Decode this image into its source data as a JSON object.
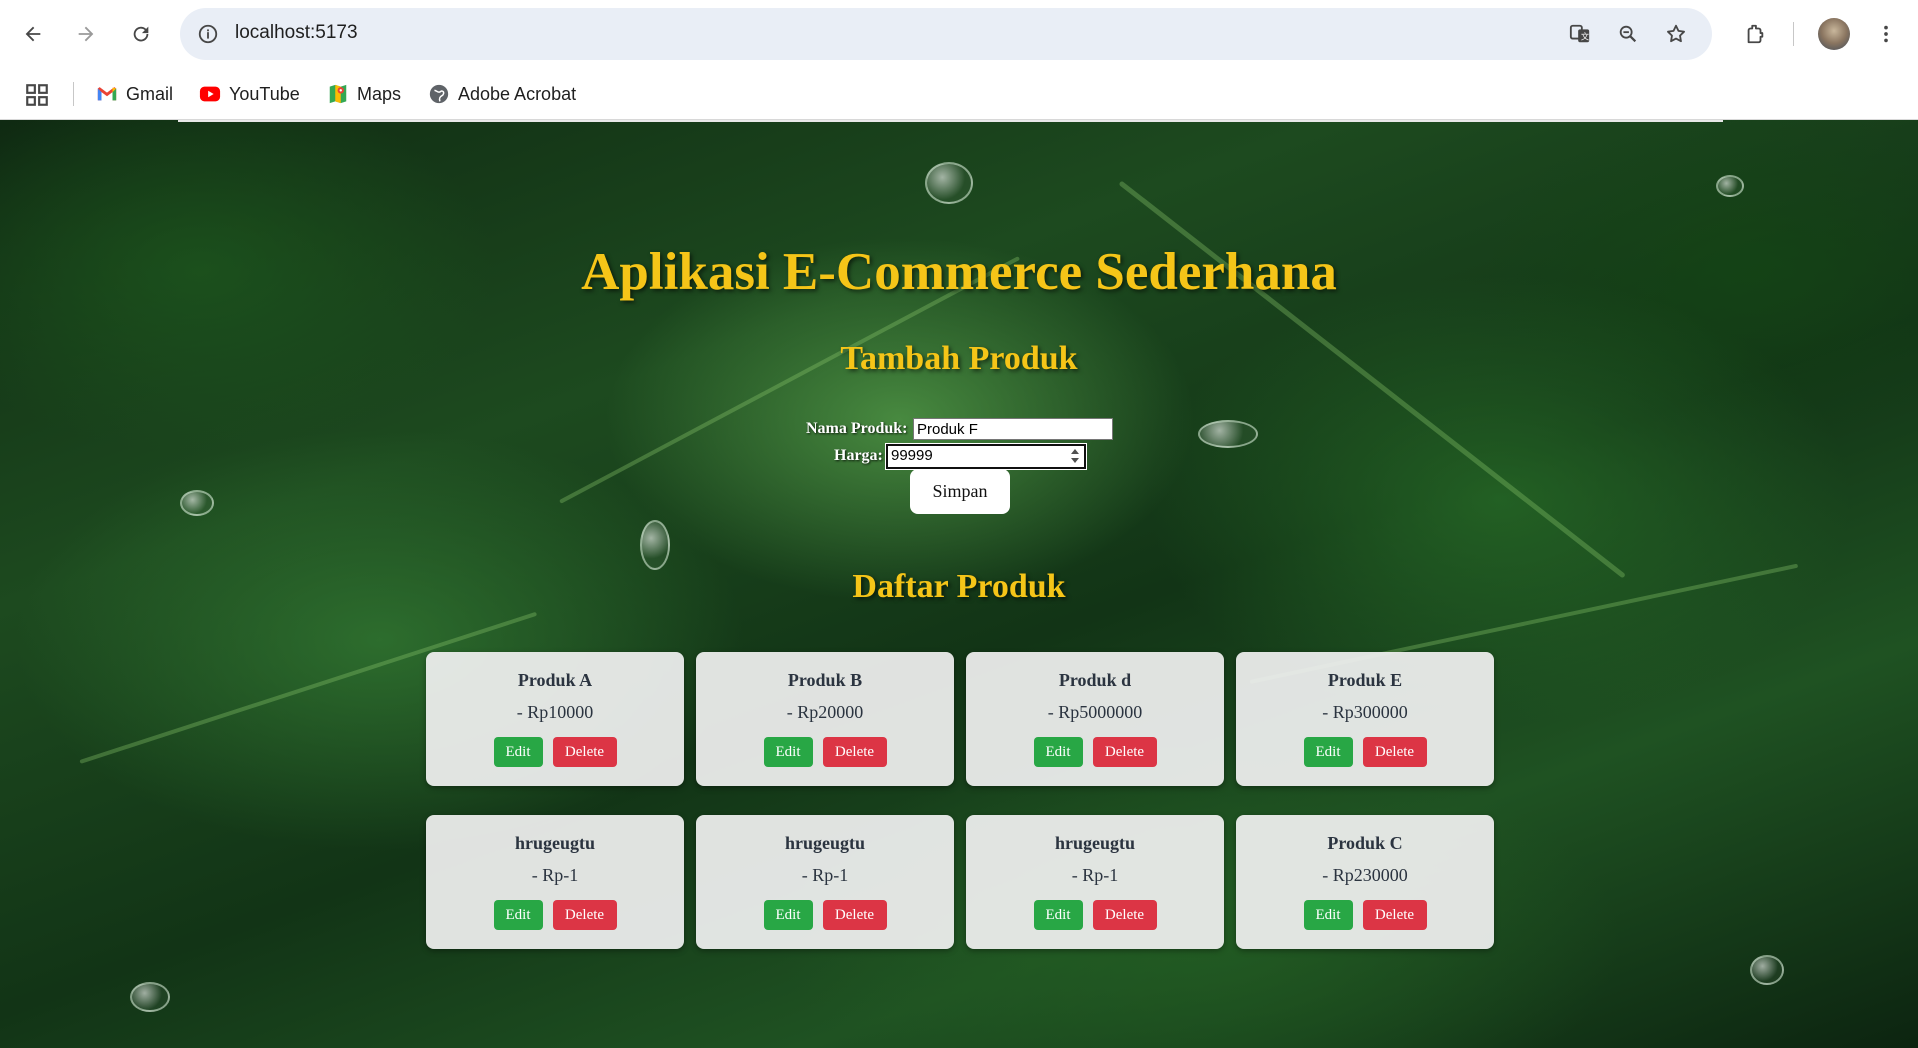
{
  "browser": {
    "url": "localhost:5173",
    "bookmarks": [
      {
        "label": "Gmail",
        "icon": "gmail-icon"
      },
      {
        "label": "YouTube",
        "icon": "youtube-icon"
      },
      {
        "label": "Maps",
        "icon": "maps-icon"
      },
      {
        "label": "Adobe Acrobat",
        "icon": "globe-icon"
      }
    ]
  },
  "app": {
    "title": "Aplikasi E-Commerce Sederhana",
    "form": {
      "heading": "Tambah Produk",
      "name_label": "Nama Produk:",
      "name_value": "Produk F",
      "price_label": "Harga:",
      "price_value": "99999",
      "submit_label": "Simpan"
    },
    "list_heading": "Daftar Produk",
    "products": [
      {
        "name": "Produk A",
        "price": "- Rp10000"
      },
      {
        "name": "Produk B",
        "price": "- Rp20000"
      },
      {
        "name": "Produk d",
        "price": "- Rp5000000"
      },
      {
        "name": "Produk E",
        "price": "- Rp300000"
      },
      {
        "name": "hrugeugtu",
        "price": "- Rp-1"
      },
      {
        "name": "hrugeugtu",
        "price": "- Rp-1"
      },
      {
        "name": "hrugeugtu",
        "price": "- Rp-1"
      },
      {
        "name": "Produk C",
        "price": "- Rp230000"
      }
    ],
    "edit_label": "Edit",
    "delete_label": "Delete"
  },
  "colors": {
    "title": "#f5c518",
    "edit": "#28a745",
    "delete": "#dc3545"
  }
}
